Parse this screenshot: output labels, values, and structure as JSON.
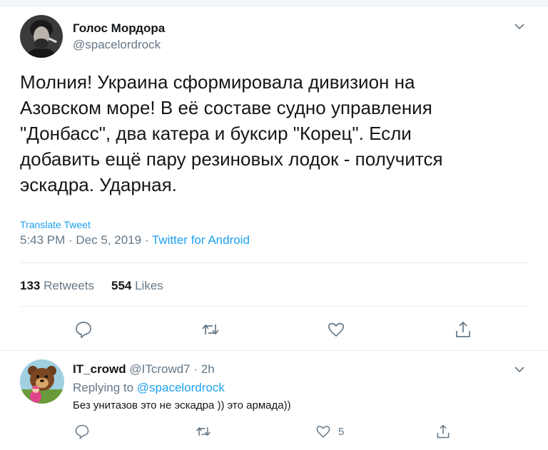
{
  "tweet": {
    "author_name": "Голос Мордора",
    "author_handle": "@spacelordrock",
    "text": "Молния! Украина сформировала дивизион на\nАзовском море! В её составе судно управления\n\"Донбасс\", два катера и буксир \"Корец\". Если\nдобавить ещё пару резиновых лодок - получится\nэскадра. Ударная.",
    "translate_label": "Translate Tweet",
    "timestamp": "5:43 PM · Dec 5, 2019 · ",
    "source": "Twitter for Android",
    "retweets_count": "133",
    "retweets_label": "Retweets",
    "likes_count": "554",
    "likes_label": "Likes"
  },
  "reply": {
    "author_name": "IT_crowd",
    "author_handle": "@ITcrowd7",
    "time": "2h",
    "replying_prefix": "Replying to ",
    "replying_to": "@spacelordrock",
    "text": "Без унитазов это не эскадра )) это армада))",
    "likes_count": "5"
  },
  "icons": [
    "caret-down-icon",
    "reply-icon",
    "retweet-icon",
    "like-icon",
    "share-icon"
  ],
  "colors": {
    "link": "#1da1f2",
    "secondary": "#657786",
    "text": "#14171a",
    "divider": "#e6ecf0"
  }
}
